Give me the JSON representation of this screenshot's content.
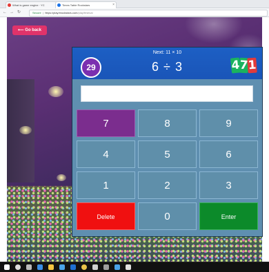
{
  "browser": {
    "tabs": [
      {
        "label": "What is game engine · YC",
        "favicon_color": "#e53935"
      },
      {
        "label": "Times Table Rockstars",
        "favicon_color": "#1a73e8"
      }
    ],
    "address": {
      "security": "Secure",
      "host": "https://play.ttrockstars.com",
      "path": "/play/festival"
    }
  },
  "game": {
    "back_label": "Go back",
    "next_label": "Next: 11 × 10",
    "timer": "29",
    "question": "6 ÷ 3",
    "logo": {
      "d1": "4",
      "d2": "7",
      "d3": "1"
    },
    "answer_value": "",
    "keys": [
      "7",
      "8",
      "9",
      "4",
      "5",
      "6",
      "1",
      "2",
      "3",
      "Delete",
      "0",
      "Enter"
    ]
  },
  "colors": {
    "header": "#1d5fc4",
    "timer": "#7b2fb0",
    "key_default": "#5f8faa",
    "key_highlight": "#7b2d8e",
    "delete": "#f01010",
    "enter": "#0c8a2a"
  },
  "taskbar": {
    "icons": [
      "start-icon",
      "search-icon",
      "task-view-icon",
      "edge-icon",
      "explorer-icon",
      "store-icon",
      "mail-icon",
      "chrome-icon",
      "photos-icon",
      "media-icon",
      "settings-icon",
      "app-icon"
    ]
  }
}
